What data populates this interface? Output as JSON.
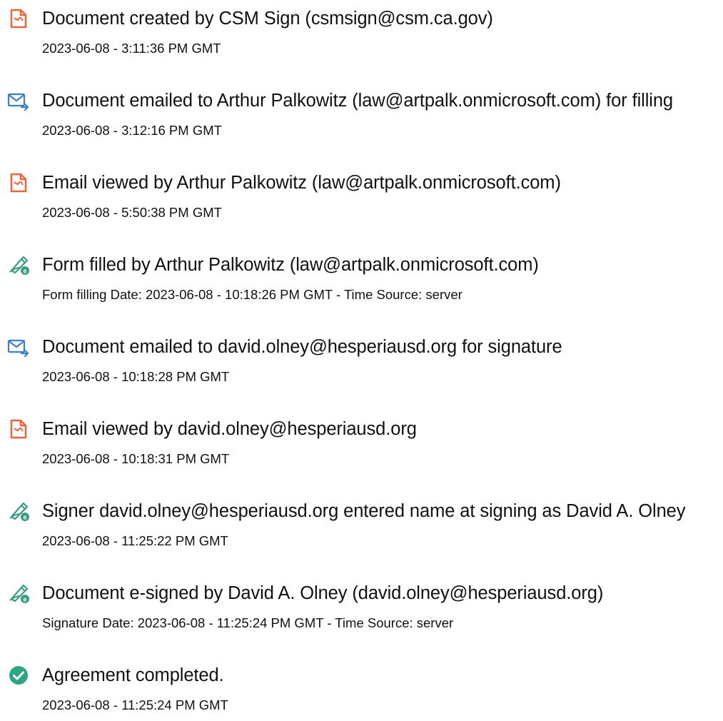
{
  "colors": {
    "doc_icon": "#e8663d",
    "mail_icon": "#3d7ec9",
    "pen_icon": "#3a9a85",
    "check_icon": "#2ea584"
  },
  "events": [
    {
      "icon": "document-icon",
      "title": "Document created by CSM Sign (csmsign@csm.ca.gov)",
      "detail": "2023-06-08 - 3:11:36 PM GMT"
    },
    {
      "icon": "email-icon",
      "title": "Document emailed to Arthur Palkowitz (law@artpalk.onmicrosoft.com) for filling",
      "detail": "2023-06-08 - 3:12:16 PM GMT"
    },
    {
      "icon": "document-icon",
      "title": "Email viewed by Arthur Palkowitz (law@artpalk.onmicrosoft.com)",
      "detail": "2023-06-08 - 5:50:38 PM GMT"
    },
    {
      "icon": "pen-sign-icon",
      "title": "Form filled by Arthur Palkowitz (law@artpalk.onmicrosoft.com)",
      "detail": "Form filling Date: 2023-06-08 - 10:18:26 PM GMT - Time Source: server"
    },
    {
      "icon": "email-icon",
      "title": "Document emailed to david.olney@hesperiausd.org for signature",
      "detail": "2023-06-08 - 10:18:28 PM GMT"
    },
    {
      "icon": "document-icon",
      "title": "Email viewed by david.olney@hesperiausd.org",
      "detail": "2023-06-08 - 10:18:31 PM GMT"
    },
    {
      "icon": "pen-sign-icon",
      "title": "Signer david.olney@hesperiausd.org entered name at signing as David A. Olney",
      "detail": "2023-06-08 - 11:25:22 PM GMT"
    },
    {
      "icon": "pen-sign-icon",
      "title": "Document e-signed by David A. Olney (david.olney@hesperiausd.org)",
      "detail": "Signature Date: 2023-06-08 - 11:25:24 PM GMT - Time Source: server"
    },
    {
      "icon": "check-circle-icon",
      "title": "Agreement completed.",
      "detail": "2023-06-08 - 11:25:24 PM GMT"
    }
  ]
}
